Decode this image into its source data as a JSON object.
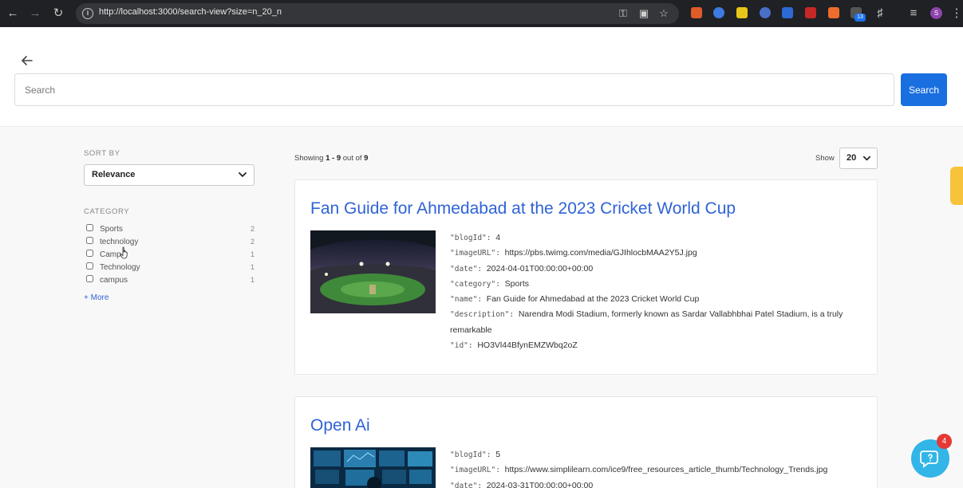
{
  "browser": {
    "url": "http://localhost:3000/search-view?size=n_20_n",
    "extension_badge": "13",
    "profile_initial": "S"
  },
  "search": {
    "placeholder": "Search",
    "button_label": "Search"
  },
  "sidebar": {
    "sort_label": "SORT BY",
    "sort_value": "Relevance",
    "category_label": "CATEGORY",
    "facets": [
      {
        "label": "Sports",
        "count": "2"
      },
      {
        "label": "technology",
        "count": "2"
      },
      {
        "label": "Camp",
        "count": "1"
      },
      {
        "label": "Technology",
        "count": "1"
      },
      {
        "label": "campus",
        "count": "1"
      }
    ],
    "more_label": "+ More"
  },
  "results_header": {
    "showing_prefix": "Showing",
    "showing_range": "1 - 9",
    "showing_mid": "out of",
    "showing_total": "9",
    "show_label": "Show",
    "page_size": "20"
  },
  "results": [
    {
      "title": "Fan Guide for Ahmedabad at the 2023 Cricket World Cup",
      "fields": [
        {
          "key": "\"blogId\"",
          "value": "4"
        },
        {
          "key": "\"imageURL\"",
          "value": "https://pbs.twimg.com/media/GJIhlocbMAA2Y5J.jpg"
        },
        {
          "key": "\"date\"",
          "value": "2024-04-01T00:00:00+00:00"
        },
        {
          "key": "\"category\"",
          "value": "Sports"
        },
        {
          "key": "\"name\"",
          "value": "Fan Guide for Ahmedabad at the 2023 Cricket World Cup"
        },
        {
          "key": "\"description\"",
          "value": "Narendra Modi Stadium, formerly known as Sardar Vallabhbhai Patel Stadium, is a truly remarkable"
        },
        {
          "key": "\"id\"",
          "value": "HO3Vl44BfynEMZWbq2oZ"
        }
      ]
    },
    {
      "title": "Open Ai",
      "fields": [
        {
          "key": "\"blogId\"",
          "value": "5"
        },
        {
          "key": "\"imageURL\"",
          "value": "https://www.simplilearn.com/ice9/free_resources_article_thumb/Technology_Trends.jpg"
        },
        {
          "key": "\"date\"",
          "value": "2024-03-31T00:00:00+00:00"
        }
      ]
    }
  ],
  "chat": {
    "badge_count": "4"
  }
}
